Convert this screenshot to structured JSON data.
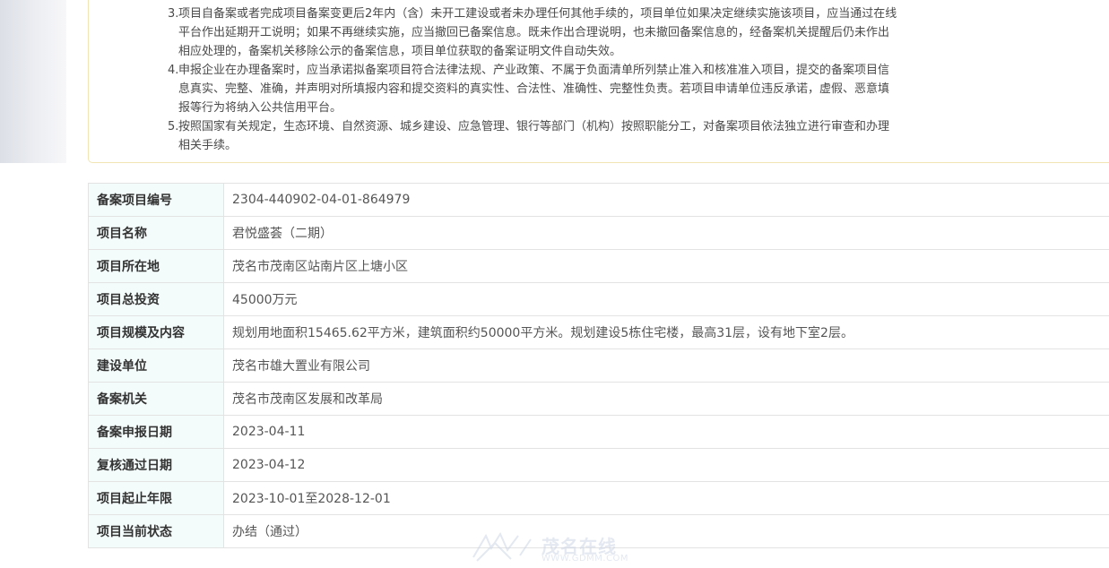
{
  "notice": {
    "items": [
      {
        "num": "3.",
        "lines": [
          "项目自备案或者完成项目备案变更后2年内（含）未开工建设或者未办理任何其他手续的，项目单位如果决定继续实施该项目，应当通过在线",
          "平台作出延期开工说明；如果不再继续实施，应当撤回已备案信息。既未作出合理说明，也未撤回备案信息的，经备案机关提醒后仍未作出",
          "相应处理的，备案机关移除公示的备案信息，项目单位获取的备案证明文件自动失效。"
        ]
      },
      {
        "num": "4.",
        "lines": [
          "申报企业在办理备案时，应当承诺拟备案项目符合法律法规、产业政策、不属于负面清单所列禁止准入和核准准入项目，提交的备案项目信",
          "息真实、完整、准确，并声明对所填报内容和提交资料的真实性、合法性、准确性、完整性负责。若项目申请单位违反承诺，虚假、恶意填",
          "报等行为将纳入公共信用平台。"
        ]
      },
      {
        "num": "5.",
        "lines": [
          "按照国家有关规定，生态环境、自然资源、城乡建设、应急管理、银行等部门（机构）按照职能分工，对备案项目依法独立进行审查和办理",
          "相关手续。"
        ]
      }
    ]
  },
  "table": {
    "rows": [
      {
        "label": "备案项目编号",
        "value": "2304-440902-04-01-864979"
      },
      {
        "label": "项目名称",
        "value": "君悦盛荟（二期）"
      },
      {
        "label": "项目所在地",
        "value": "茂名市茂南区站南片区上塘小区"
      },
      {
        "label": "项目总投资",
        "value": "45000万元"
      },
      {
        "label": "项目规模及内容",
        "value": "规划用地面积15465.62平方米，建筑面积约50000平方米。规划建设5栋住宅楼，最高31层，设有地下室2层。"
      },
      {
        "label": "建设单位",
        "value": "茂名市雄大置业有限公司"
      },
      {
        "label": "备案机关",
        "value": "茂名市茂南区发展和改革局"
      },
      {
        "label": "备案申报日期",
        "value": "2023-04-11"
      },
      {
        "label": "复核通过日期",
        "value": "2023-04-12"
      },
      {
        "label": "项目起止年限",
        "value": "2023-10-01至2028-12-01"
      },
      {
        "label": "项目当前状态",
        "value": "办结（通过）"
      }
    ]
  },
  "watermark": {
    "text": "茂名在线",
    "url": "WWW.GDMM.COM"
  },
  "colors": {
    "label_bg": "#f4fbfb",
    "border": "#e3e3e3",
    "notice_border": "#f1e5b3"
  }
}
